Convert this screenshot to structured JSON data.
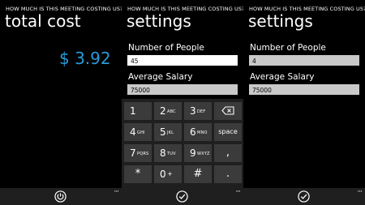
{
  "screens": [
    {
      "app_title": "HOW MUCH IS THIS MEETING COSTING US?",
      "page_title": "total cost",
      "cost": "$ 3.92",
      "app_bar": {
        "button_icon": "power-icon",
        "more": "···"
      }
    },
    {
      "app_title": "HOW MUCH IS THIS MEETING COSTING US?",
      "page_title": "settings",
      "fields": [
        {
          "label": "Number of People",
          "value": "45",
          "state": "focused"
        },
        {
          "label": "Average Salary",
          "value": "75000",
          "state": "normal"
        }
      ],
      "keypad": [
        [
          {
            "digit": "1",
            "letters": ""
          },
          {
            "digit": "2",
            "letters": "ABC"
          },
          {
            "digit": "3",
            "letters": "DEF"
          },
          {
            "glyph": "backspace-icon"
          }
        ],
        [
          {
            "digit": "4",
            "letters": "GHI"
          },
          {
            "digit": "5",
            "letters": "JKL"
          },
          {
            "digit": "6",
            "letters": "MNO"
          },
          {
            "text": "space"
          }
        ],
        [
          {
            "digit": "7",
            "letters": "PQRS"
          },
          {
            "digit": "8",
            "letters": "TUV"
          },
          {
            "digit": "9",
            "letters": "WXYZ"
          },
          {
            "text": ","
          }
        ],
        [
          {
            "text": "*"
          },
          {
            "digit": "0",
            "letters": "+"
          },
          {
            "text": "#"
          },
          {
            "text": "."
          }
        ]
      ],
      "app_bar": {
        "button_icon": "check-icon",
        "more": "···"
      }
    },
    {
      "app_title": "HOW MUCH IS THIS MEETING COSTING US?",
      "page_title": "settings",
      "fields": [
        {
          "label": "Number of People",
          "value": "4",
          "state": "disabled"
        },
        {
          "label": "Average Salary",
          "value": "75000",
          "state": "disabled"
        }
      ],
      "app_bar": {
        "button_icon": "check-icon",
        "more": "···"
      }
    }
  ],
  "colors": {
    "accent": "#2a9ad8",
    "background": "#000000",
    "key": "#3b3b3b",
    "field_disabled": "#c9c9c9"
  }
}
